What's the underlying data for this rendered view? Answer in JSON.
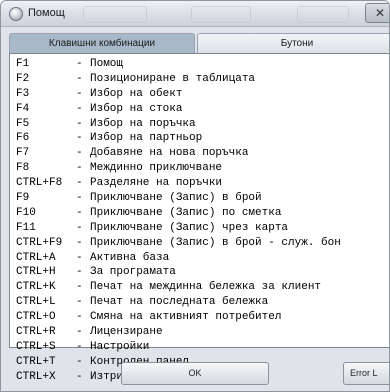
{
  "window": {
    "title": "Помощ"
  },
  "tabs": [
    {
      "label": "Клавишни комбинации",
      "active": true
    },
    {
      "label": "Бутони",
      "active": false
    }
  ],
  "shortcuts": [
    {
      "key": "F1",
      "description": "Помощ"
    },
    {
      "key": "F2",
      "description": "Позициониране в таблицата"
    },
    {
      "key": "F3",
      "description": "Избор на обект"
    },
    {
      "key": "F4",
      "description": "Избор на стока"
    },
    {
      "key": "F5",
      "description": "Избор на поръчка"
    },
    {
      "key": "F6",
      "description": "Избор на партньор"
    },
    {
      "key": "F7",
      "description": "Добавяне на нова поръчка"
    },
    {
      "key": "F8",
      "description": "Междинно приключване"
    },
    {
      "key": "CTRL+F8",
      "description": "Разделяне на поръчки"
    },
    {
      "key": "F9",
      "description": "Приключване (Запис) в брой"
    },
    {
      "key": "F10",
      "description": "Приключване (Запис) по сметка"
    },
    {
      "key": "F11",
      "description": "Приключване (Запис) чрез карта"
    },
    {
      "key": "CTRL+F9",
      "description": "Приключване (Запис) в брой - служ. бон"
    },
    {
      "key": "CTRL+A",
      "description": "Активна база"
    },
    {
      "key": "CTRL+H",
      "description": "За програмата"
    },
    {
      "key": "CTRL+K",
      "description": "Печат на междинна бележка за клиент"
    },
    {
      "key": "CTRL+L",
      "description": "Печат на последната бележка"
    },
    {
      "key": "CTRL+O",
      "description": "Смяна на активният потребител"
    },
    {
      "key": "CTRL+R",
      "description": "Лицензиране"
    },
    {
      "key": "CTRL+S",
      "description": "Настройки"
    },
    {
      "key": "CTRL+T",
      "description": "Контролен панел"
    },
    {
      "key": "CTRL+X",
      "description": "Изтриване на маркирания ред"
    }
  ],
  "separator": "-",
  "buttons": {
    "ok_label": "OK",
    "error_label": "Error L"
  },
  "colors": {
    "active_tab": "#a9b8c9",
    "window_bg": "#dfe3ea"
  }
}
